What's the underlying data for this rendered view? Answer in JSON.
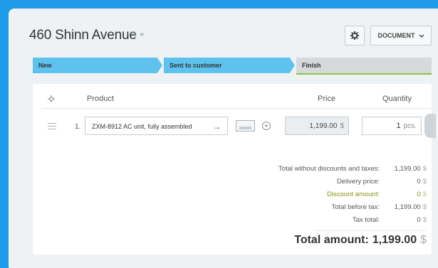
{
  "deal": {
    "title": "460 Shinn Avenue"
  },
  "toolbar": {
    "settings_icon": "gear-icon",
    "document_label": "DOCUMENT"
  },
  "stages": [
    {
      "label": "New"
    },
    {
      "label": "Sent to customer"
    },
    {
      "label": "Finish"
    }
  ],
  "table": {
    "headers": {
      "product": "Product",
      "price": "Price",
      "quantity": "Quantity"
    },
    "rows": [
      {
        "number": "1.",
        "product": "ZXM-8912 AC unit, fully assembled",
        "price": "1,199.00",
        "currency": "$",
        "quantity": "1",
        "unit": "pcs."
      }
    ]
  },
  "totals": {
    "without_discounts_label": "Total without discounts and taxes:",
    "without_discounts_value": "1,199.00",
    "delivery_label": "Delivery price:",
    "delivery_value": "0",
    "discount_label": "Discount amount:",
    "discount_value": "0",
    "before_tax_label": "Total before tax:",
    "before_tax_value": "1,199.00",
    "tax_label": "Tax total:",
    "tax_value": "0",
    "currency": "$",
    "grand_label": "Total amount:",
    "grand_value": "1,199.00"
  },
  "colors": {
    "background": "#1e9be8",
    "stage_active": "#5ec2ef",
    "stage_inactive": "#d5d9dc",
    "discount": "#8a8f1c"
  }
}
